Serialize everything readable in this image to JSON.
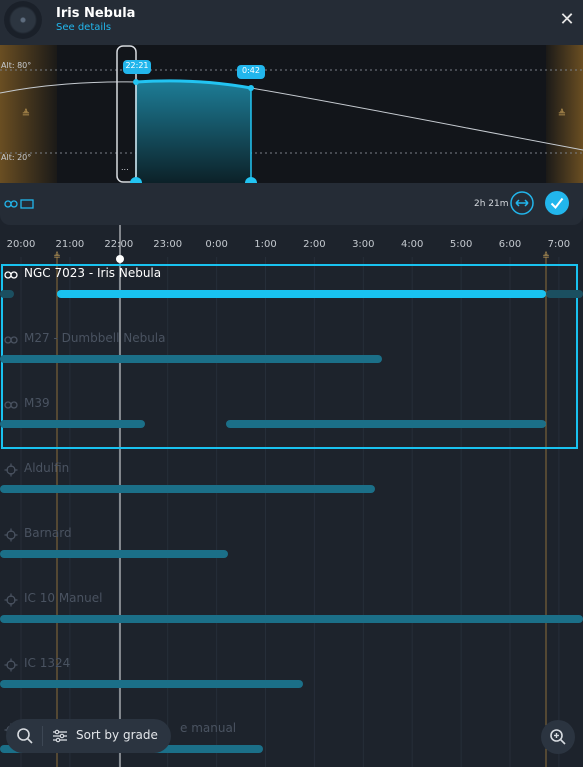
{
  "header": {
    "title": "Iris Nebula",
    "link": "See details",
    "close_icon": "close-icon"
  },
  "altitude": {
    "label_high": "Alt: 80°",
    "label_low": "Alt: 20°",
    "start_badge": "22:21",
    "end_badge": "0:42",
    "now_handle_text": "..."
  },
  "controls": {
    "duration": "2h 21m",
    "accent": "#19c2f0"
  },
  "timeline": {
    "hours": [
      "20:00",
      "21:00",
      "22:00",
      "23:00",
      "0:00",
      "1:00",
      "2:00",
      "3:00",
      "4:00",
      "5:00",
      "6:00",
      "7:00"
    ],
    "rows": [
      {
        "name": "NGC 7023 - Iris Nebula",
        "icon": "linked-icon",
        "active": true
      },
      {
        "name": "M27 - Dumbbell Nebula",
        "icon": "linked-icon",
        "active": false
      },
      {
        "name": "M39",
        "icon": "linked-icon",
        "active": false
      },
      {
        "name": "Aldulfin",
        "icon": "crosshair-icon",
        "active": false
      },
      {
        "name": "Barnard",
        "icon": "crosshair-icon",
        "active": false
      },
      {
        "name": "IC 10 Manuel",
        "icon": "crosshair-icon",
        "active": false
      },
      {
        "name": "IC 1324",
        "icon": "crosshair-icon",
        "active": false
      },
      {
        "name": "e manual",
        "icon": "crosshair-icon",
        "active": false
      }
    ]
  },
  "bottom": {
    "sort_label": "Sort by grade",
    "search_icon": "search-icon",
    "zoom_icon": "zoom-in-icon"
  }
}
